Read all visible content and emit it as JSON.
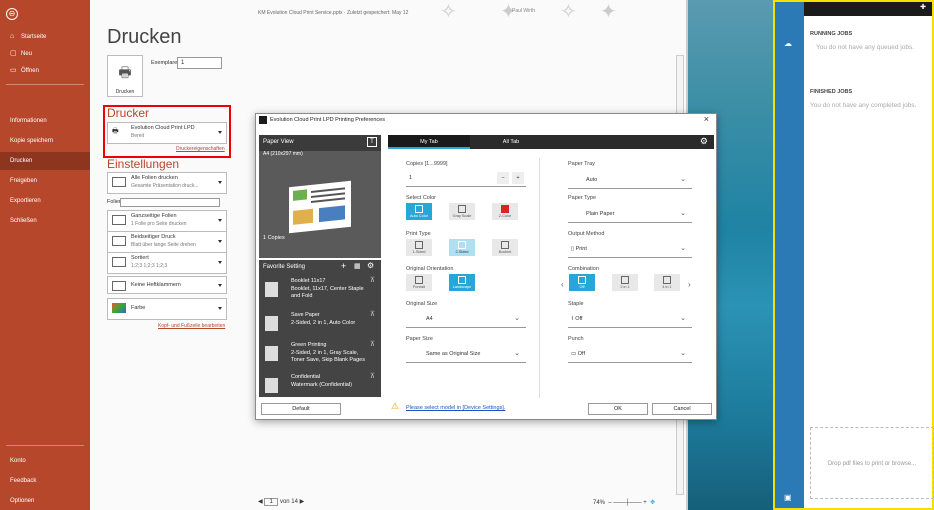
{
  "window": {
    "title": "KM Evolution Cloud Print Service.pptx",
    "saved_status": "Zuletzt gespeichert: May 12",
    "user": "Paul Wirth"
  },
  "nav": {
    "back": "⊖",
    "items": [
      {
        "label": "Startseite",
        "icon": "⌂"
      },
      {
        "label": "Neu",
        "icon": "▢"
      },
      {
        "label": "Öffnen",
        "icon": "▭"
      },
      {
        "label": "Informationen"
      },
      {
        "label": "Kopie speichern"
      },
      {
        "label": "Drucken"
      },
      {
        "label": "Freigeben"
      },
      {
        "label": "Exportieren"
      },
      {
        "label": "Schließen"
      }
    ],
    "bottom": [
      {
        "label": "Konto"
      },
      {
        "label": "Feedback"
      },
      {
        "label": "Optionen"
      }
    ]
  },
  "print": {
    "heading": "Drucken",
    "print_button": "Drucken",
    "copies_label": "Exemplare:",
    "copies_value": "1",
    "printer_heading": "Drucker",
    "printer_name": "Evolution Cloud Print LPD",
    "printer_status": "Bereit",
    "printer_props": "Druckereigenschaften",
    "settings_heading": "Einstellungen",
    "all_slides": "Alle Folien drucken",
    "all_slides_sub": "Gesamte Präsentation druck...",
    "slides_label": "Folien:",
    "full_page": "Ganzseitige Folien",
    "full_page_sub": "1 Folie pro Seite drucken",
    "duplex": "Beidseitiger Druck",
    "duplex_sub": "Blatt über lange Seite drehen",
    "collate": "Sortiert",
    "collate_sub": "1;2;3   1;2;3   1;2;3",
    "staple": "Keine Heftklammern",
    "color": "Farbe",
    "header_footer": "Kopf- und Fußzeile bearbeiten",
    "page_current": "1",
    "page_total": "von 14",
    "zoom": "74%"
  },
  "dialog": {
    "title": "Evolution Cloud Print LPD Printing Preferences",
    "paper_view": "Paper View",
    "paper_size_label": "A4 (210x297 mm)",
    "copies_caption": "1 Copies",
    "favorite_setting": "Favorite Setting",
    "favorites": [
      {
        "title": "Booklet 11x17",
        "desc": "Booklet, 11x17, Center Staple and Fold"
      },
      {
        "title": "Save Paper",
        "desc": "2-Sided, 2 in 1, Auto Color"
      },
      {
        "title": "Green Printing",
        "desc": "2-Sided, 2 in 1, Gray Scale, Toner Save, Skip Blank Pages"
      },
      {
        "title": "Confidential",
        "desc": "Watermark (Confidential)"
      }
    ],
    "tabs": [
      "My Tab",
      "All Tab"
    ],
    "copies_field_label": "Copies [1...9999]",
    "copies_value": "1",
    "select_color": "Select Color",
    "color_options": [
      "Auto Color",
      "Gray Scale",
      "2-Color"
    ],
    "print_type": "Print Type",
    "print_type_options": [
      "1-Sided",
      "2-Sided",
      "Booklet"
    ],
    "orientation": "Original Orientation",
    "orientation_options": [
      "Portrait",
      "Landscape"
    ],
    "original_size": "Original Size",
    "original_size_value": "A4",
    "paper_size": "Paper Size",
    "paper_size_value": "Same as Original Size",
    "paper_tray": "Paper Tray",
    "paper_tray_value": "Auto",
    "paper_type": "Paper Type",
    "paper_type_value": "Plain Paper",
    "output_method": "Output Method",
    "output_method_value": "Print",
    "combination": "Combination",
    "combination_options": [
      "Off",
      "2 in 1",
      "4 in 1"
    ],
    "staple": "Staple",
    "staple_value": "Off",
    "punch": "Punch",
    "punch_value": "Off",
    "default_btn": "Default",
    "warning": "Please select model in [Device Settings].",
    "ok": "OK",
    "cancel": "Cancel"
  },
  "app": {
    "running_jobs": "RUNNING JOBS",
    "running_empty": "You do not have any queued jobs.",
    "finished_jobs": "FINISHED JOBS",
    "finished_empty": "You do not have any completed jobs.",
    "dropzone": "Drop pdf files to print or browse..."
  },
  "colors": {
    "accent": "#b7472a",
    "highlight_red": "#e00000",
    "dialog_blue": "#27a7d8",
    "app_border": "#f5e100",
    "app_side": "#2b7ab5"
  }
}
